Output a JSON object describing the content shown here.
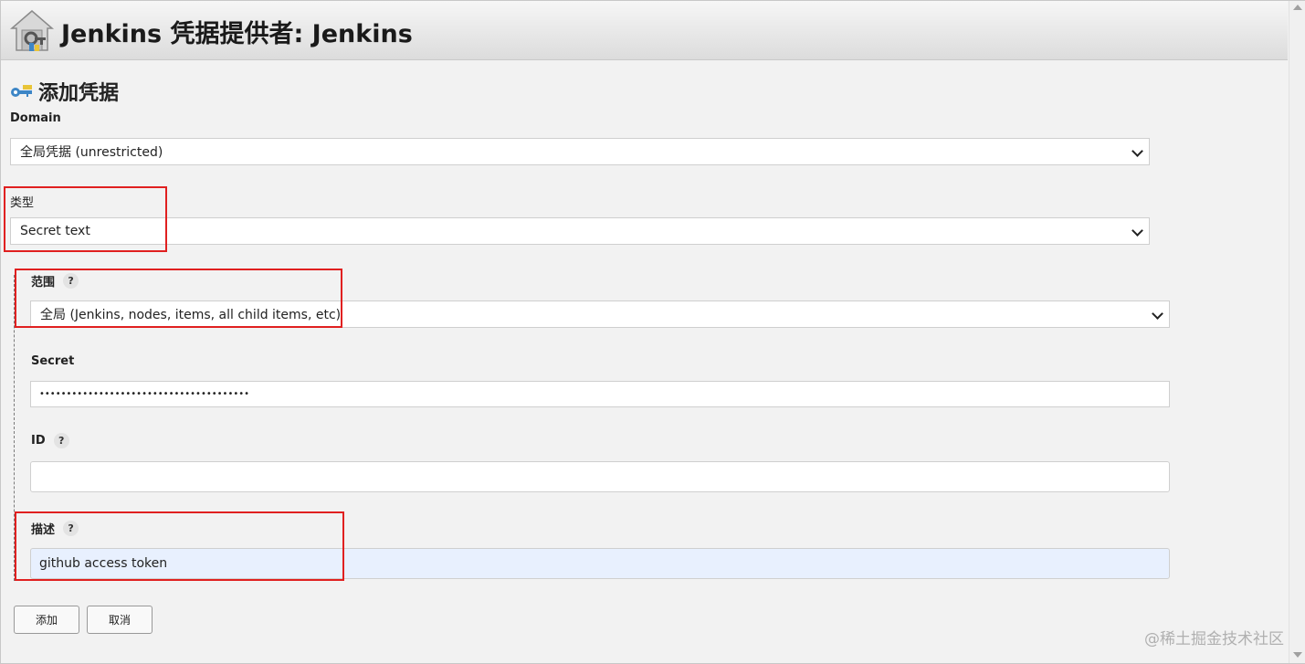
{
  "header": {
    "title": "Jenkins 凭据提供者: Jenkins",
    "icon": "credentials-house-icon"
  },
  "section": {
    "title": "添加凭据",
    "icon": "key-icon"
  },
  "domain": {
    "label": "Domain",
    "value": "全局凭据 (unrestricted)"
  },
  "type": {
    "label": "类型",
    "value": "Secret text"
  },
  "scope": {
    "label": "范围",
    "help": "?",
    "value": "全局 (Jenkins, nodes, items, all child items, etc)"
  },
  "secret": {
    "label": "Secret",
    "value": "•••••••••••••••••••••••••••••••••••••••"
  },
  "id": {
    "label": "ID",
    "help": "?",
    "value": ""
  },
  "description": {
    "label": "描述",
    "help": "?",
    "value": "github access token"
  },
  "buttons": {
    "add": "添加",
    "cancel": "取消"
  },
  "watermark": "@稀土掘金技术社区",
  "colors": {
    "highlight": "#e02020",
    "autofill": "#e8f0fe"
  }
}
